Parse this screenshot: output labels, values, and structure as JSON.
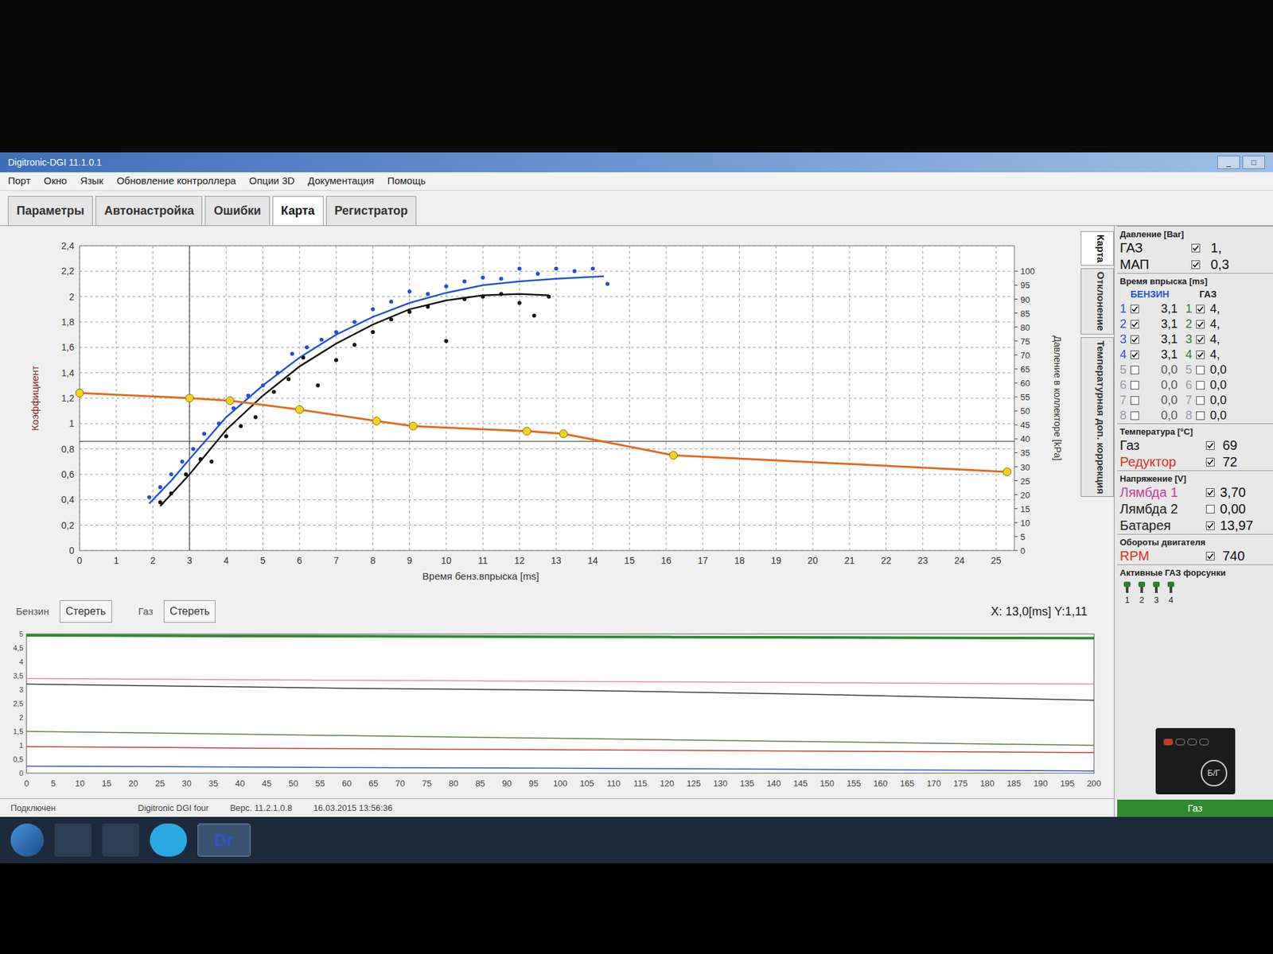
{
  "window": {
    "title": "Digitronic-DGI 11.1.0.1",
    "controls": [
      "_",
      "□"
    ]
  },
  "menu": [
    "Порт",
    "Окно",
    "Язык",
    "Обновление контроллера",
    "Опции 3D",
    "Документация",
    "Помощь"
  ],
  "tabs": [
    {
      "label": "Параметры",
      "selected": false
    },
    {
      "label": "Автонастройка",
      "selected": false
    },
    {
      "label": "Ошибки",
      "selected": false
    },
    {
      "label": "Карта",
      "selected": true
    },
    {
      "label": "Регистратор",
      "selected": false
    }
  ],
  "main_chart": {
    "y_title": "Коэффициент",
    "x_title": "Время бенз.впрыска [ms]",
    "y2_title": "Давление в коллекторе [kPa]",
    "y_ticks": [
      "0",
      "0,2",
      "0,4",
      "0,6",
      "0,8",
      "1",
      "1,2",
      "1,4",
      "1,6",
      "1,8",
      "2",
      "2,2",
      "2,4"
    ],
    "x_ticks": [
      "0",
      "1",
      "2",
      "3",
      "4",
      "5",
      "6",
      "7",
      "8",
      "9",
      "10",
      "11",
      "12",
      "13",
      "14",
      "15",
      "16",
      "17",
      "18",
      "19",
      "20",
      "21",
      "22",
      "23",
      "24",
      "25"
    ],
    "y2_ticks": [
      "0",
      "5",
      "10",
      "15",
      "20",
      "25",
      "30",
      "35",
      "40",
      "45",
      "50",
      "55",
      "60",
      "65",
      "70",
      "75",
      "80",
      "85",
      "90",
      "95",
      "100"
    ],
    "crosshair": {
      "x": 3.0,
      "y": 0.86
    },
    "series": [
      {
        "name": "benzin-dots",
        "kind": "dots",
        "color": "#1f4fd8",
        "x": [
          1.9,
          2.2,
          2.5,
          2.8,
          3.1,
          3.4,
          3.8,
          4.2,
          4.6,
          5.0,
          5.4,
          5.8,
          6.2,
          6.6,
          7.0,
          7.5,
          8.0,
          8.5,
          9.0,
          9.5,
          10.0,
          10.5,
          11.0,
          11.5,
          12.0,
          12.5,
          13.0,
          13.5,
          14.0,
          14.4
        ],
        "y": [
          0.42,
          0.5,
          0.6,
          0.7,
          0.8,
          0.92,
          1.0,
          1.12,
          1.22,
          1.3,
          1.4,
          1.55,
          1.6,
          1.66,
          1.72,
          1.8,
          1.9,
          1.96,
          2.04,
          2.02,
          2.08,
          2.12,
          2.15,
          2.14,
          2.22,
          2.18,
          2.22,
          2.2,
          2.22,
          2.1
        ]
      },
      {
        "name": "gas-dots",
        "kind": "dots",
        "color": "#111111",
        "x": [
          2.2,
          2.5,
          2.9,
          3.3,
          3.6,
          4.0,
          4.4,
          4.8,
          5.3,
          5.7,
          6.1,
          6.5,
          7.0,
          7.5,
          8.0,
          8.5,
          9.0,
          9.5,
          10.0,
          10.5,
          11.0,
          11.5,
          12.0,
          12.4,
          12.8
        ],
        "y": [
          0.38,
          0.45,
          0.6,
          0.72,
          0.7,
          0.9,
          0.98,
          1.05,
          1.25,
          1.35,
          1.52,
          1.3,
          1.5,
          1.62,
          1.72,
          1.82,
          1.88,
          1.92,
          1.65,
          1.98,
          2.0,
          2.02,
          1.95,
          1.85,
          2.0
        ]
      },
      {
        "name": "benzin-curve",
        "kind": "line",
        "color": "#1f4fd8",
        "x": [
          1.9,
          2.5,
          3.0,
          4.0,
          5.0,
          6.0,
          7.0,
          8.0,
          9.0,
          10.0,
          11.0,
          12.0,
          13.0,
          14.3
        ],
        "y": [
          0.37,
          0.55,
          0.72,
          1.05,
          1.3,
          1.52,
          1.7,
          1.84,
          1.95,
          2.03,
          2.09,
          2.12,
          2.14,
          2.16
        ]
      },
      {
        "name": "gas-curve",
        "kind": "line",
        "color": "#111111",
        "x": [
          2.2,
          3.0,
          4.0,
          5.0,
          6.0,
          7.0,
          8.0,
          9.0,
          10.0,
          11.0,
          12.0,
          12.8
        ],
        "y": [
          0.35,
          0.6,
          0.95,
          1.22,
          1.45,
          1.63,
          1.78,
          1.9,
          1.97,
          2.01,
          2.02,
          2.01
        ]
      },
      {
        "name": "correction-line",
        "kind": "markers",
        "color": "#e06a1e",
        "x": [
          0,
          3.0,
          4.1,
          6.0,
          8.1,
          9.1,
          12.2,
          13.2,
          16.2,
          25.3
        ],
        "y": [
          1.24,
          1.2,
          1.18,
          1.11,
          1.02,
          0.98,
          0.94,
          0.92,
          0.75,
          0.62
        ]
      }
    ]
  },
  "side_tabs": [
    {
      "label": "Карта",
      "selected": true
    },
    {
      "label": "Отклонение",
      "selected": false
    },
    {
      "label": "Температурная доп. коррекция",
      "selected": false
    }
  ],
  "legend": {
    "benzin": "Бензин",
    "benzin_clear": "Стереть",
    "gas": "Газ",
    "gas_clear": "Стереть"
  },
  "cursor_readout": "X: 13,0[ms] Y:1,11",
  "lower_chart": {
    "y_ticks": [
      "0",
      "0,5",
      "1",
      "1,5",
      "2",
      "2,5",
      "3",
      "3,5",
      "4",
      "4,5",
      "5"
    ],
    "x_ticks": [
      "0",
      "5",
      "10",
      "15",
      "20",
      "25",
      "30",
      "35",
      "40",
      "45",
      "50",
      "55",
      "60",
      "65",
      "70",
      "75",
      "80",
      "85",
      "90",
      "95",
      "100",
      "105",
      "110",
      "115",
      "120",
      "125",
      "130",
      "135",
      "140",
      "145",
      "150",
      "155",
      "160",
      "165",
      "170",
      "175",
      "180",
      "185",
      "190",
      "195",
      "200"
    ],
    "series": [
      {
        "name": "battery",
        "color": "#2e8b2e",
        "values": [
          4.95,
          4.94,
          4.93,
          4.92,
          4.91,
          4.9,
          4.89,
          4.88,
          4.87,
          4.86,
          4.85
        ]
      },
      {
        "name": "lambda",
        "color": "#d98bb5",
        "values": [
          3.4,
          3.38,
          3.36,
          3.34,
          3.32,
          3.3,
          3.28,
          3.26,
          3.24,
          3.22,
          3.2
        ]
      },
      {
        "name": "rpm",
        "color": "#333333",
        "values": [
          3.2,
          3.15,
          3.1,
          3.05,
          3.02,
          2.98,
          2.92,
          2.86,
          2.78,
          2.7,
          2.62
        ]
      },
      {
        "name": "gas-pressure",
        "color": "#c0392b",
        "values": [
          0.95,
          0.93,
          0.9,
          0.88,
          0.86,
          0.84,
          0.82,
          0.8,
          0.78,
          0.76,
          0.74
        ]
      },
      {
        "name": "gas-injection",
        "color": "#5a7a3a",
        "values": [
          1.5,
          1.45,
          1.4,
          1.35,
          1.3,
          1.25,
          1.2,
          1.15,
          1.1,
          1.05,
          1.0
        ]
      },
      {
        "name": "benzin-injection",
        "color": "#2050c0",
        "values": [
          0.25,
          0.24,
          0.22,
          0.2,
          0.19,
          0.18,
          0.16,
          0.14,
          0.12,
          0.1,
          0.08
        ]
      }
    ]
  },
  "status_bar": {
    "state": "Подключен",
    "device": "Digitronic DGI four",
    "version": "Верс. 11.2.1.0.8",
    "datetime": "16.03.2015 13:56:36"
  },
  "right_panel": {
    "pressure": {
      "title": "Давление [Bar]",
      "rows": [
        {
          "label": "ГАЗ",
          "checked": true,
          "value": "1,"
        },
        {
          "label": "МАП",
          "checked": true,
          "value": "0,3"
        }
      ]
    },
    "injection": {
      "title": "Время впрыска [ms]",
      "col_benzin": "БЕНЗИН",
      "col_gas": "ГАЗ",
      "rows": [
        {
          "num": "1",
          "benzin_checked": true,
          "benzin": "3,1",
          "gas_checked": true,
          "gas": "4,"
        },
        {
          "num": "2",
          "benzin_checked": true,
          "benzin": "3,1",
          "gas_checked": true,
          "gas": "4,"
        },
        {
          "num": "3",
          "benzin_checked": true,
          "benzin": "3,1",
          "gas_checked": true,
          "gas": "4,"
        },
        {
          "num": "4",
          "benzin_checked": true,
          "benzin": "3,1",
          "gas_checked": true,
          "gas": "4,"
        },
        {
          "num": "5",
          "benzin_checked": false,
          "benzin": "0,0",
          "gas_checked": false,
          "gas": "0,0"
        },
        {
          "num": "6",
          "benzin_checked": false,
          "benzin": "0,0",
          "gas_checked": false,
          "gas": "0,0"
        },
        {
          "num": "7",
          "benzin_checked": false,
          "benzin": "0,0",
          "gas_checked": false,
          "gas": "0,0"
        },
        {
          "num": "8",
          "benzin_checked": false,
          "benzin": "0,0",
          "gas_checked": false,
          "gas": "0,0"
        }
      ]
    },
    "temperature": {
      "title": "Температура [°C]",
      "rows": [
        {
          "label": "Газ",
          "checked": true,
          "value": "69",
          "color": "#111111"
        },
        {
          "label": "Редуктор",
          "checked": true,
          "value": "72",
          "color": "#e0301e"
        }
      ]
    },
    "voltage": {
      "title": "Напряжение [V]",
      "rows": [
        {
          "label": "Лямбда 1",
          "checked": true,
          "value": "3,70",
          "color": "#c2409a"
        },
        {
          "label": "Лямбда 2",
          "checked": false,
          "value": "0,00",
          "color": "#222222"
        },
        {
          "label": "Батарея",
          "checked": true,
          "value": "13,97",
          "color": "#222222"
        }
      ]
    },
    "rpm": {
      "title": "Обороты двигателя",
      "label": "RPM",
      "checked": true,
      "value": "740"
    },
    "injectors": {
      "title": "Активные ГАЗ форсунки",
      "items": [
        {
          "num": "1",
          "active": true
        },
        {
          "num": "2",
          "active": true
        },
        {
          "num": "3",
          "active": true
        },
        {
          "num": "4",
          "active": true
        }
      ]
    },
    "switch": {
      "label": "Б/Г"
    },
    "mode": "Газ"
  },
  "taskbar": {
    "app_label": "Dг"
  }
}
